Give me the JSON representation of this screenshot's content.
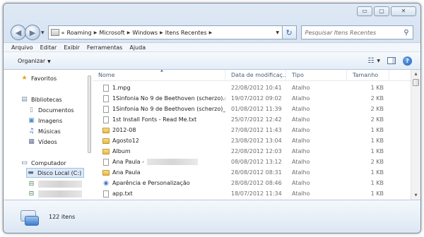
{
  "window": {
    "caption": {
      "minimize": "▭",
      "maximize": "▢",
      "close": "✕"
    }
  },
  "nav": {
    "back_icon": "back-arrow-icon",
    "forward_icon": "forward-arrow-icon",
    "address": {
      "overflow": "«",
      "crumbs": [
        "Roaming",
        "Microsoft",
        "Windows",
        "Itens Recentes"
      ]
    },
    "search_placeholder": "Pesquisar Itens Recentes"
  },
  "menubar": [
    "Arquivo",
    "Editar",
    "Exibir",
    "Ferramentas",
    "Ajuda"
  ],
  "toolbar": {
    "organize_label": "Organizar"
  },
  "navpane": {
    "items": [
      {
        "label": "Favoritos",
        "icon": "star-icon",
        "glyph": "★",
        "color": "#e7a11b"
      },
      {
        "label": "Bibliotecas",
        "icon": "libraries-icon",
        "glyph": "▤",
        "color": "#7a8ca6"
      },
      {
        "label": "Documentos",
        "icon": "documents-icon",
        "glyph": "▯",
        "color": "#8a8a8a"
      },
      {
        "label": "Imagens",
        "icon": "pictures-icon",
        "glyph": "▣",
        "color": "#4f8bc9"
      },
      {
        "label": "Músicas",
        "icon": "music-icon",
        "glyph": "♫",
        "color": "#3d6db5"
      },
      {
        "label": "Vídeos",
        "icon": "videos-icon",
        "glyph": "▦",
        "color": "#5a6f8f"
      },
      {
        "label": "Computador",
        "icon": "computer-icon",
        "glyph": "▭",
        "color": "#3a5a8a"
      },
      {
        "label": "Disco Local (C:)",
        "icon": "drive-icon",
        "glyph": "▬",
        "color": "#5c6f87"
      },
      {
        "label": "",
        "icon": "network-drive-icon",
        "glyph": "⊟",
        "color": "#3e7c3e"
      },
      {
        "label": "",
        "icon": "network-drive-icon",
        "glyph": "⊟",
        "color": "#3e7c3e"
      }
    ]
  },
  "files": {
    "columns": [
      "Nome",
      "Data de modificaç...",
      "Tipo",
      "Tamanho"
    ],
    "rows": [
      {
        "name": "1.mpg",
        "date": "22/08/2012 10:41",
        "type": "Atalho",
        "size": "1 KB",
        "icon": "doc"
      },
      {
        "name": "1Sinfonia No 9 de Beethoven (scherzo).m...",
        "date": "19/07/2012 09:02",
        "type": "Atalho",
        "size": "2 KB",
        "icon": "doc"
      },
      {
        "name": "1Sinfonia No 9 de Beethoven (scherzo)_tr...",
        "date": "01/08/2012 11:39",
        "type": "Atalho",
        "size": "2 KB",
        "icon": "doc"
      },
      {
        "name": "1st Install Fonts - Read Me.txt",
        "date": "25/07/2012 12:42",
        "type": "Atalho",
        "size": "2 KB",
        "icon": "doc"
      },
      {
        "name": "2012-08",
        "date": "27/08/2012 11:43",
        "type": "Atalho",
        "size": "1 KB",
        "icon": "folder"
      },
      {
        "name": "Agosto12",
        "date": "23/08/2012 13:04",
        "type": "Atalho",
        "size": "1 KB",
        "icon": "folder"
      },
      {
        "name": "Album",
        "date": "22/08/2012 12:03",
        "type": "Atalho",
        "size": "1 KB",
        "icon": "folder"
      },
      {
        "name": "Ana Paula -",
        "date": "08/08/2012 13:12",
        "type": "Atalho",
        "size": "2 KB",
        "icon": "doc",
        "redacted": true
      },
      {
        "name": "Ana Paula",
        "date": "28/08/2012 08:31",
        "type": "Atalho",
        "size": "1 KB",
        "icon": "folder"
      },
      {
        "name": "Aparência e Personalização",
        "date": "28/08/2012 08:46",
        "type": "Atalho",
        "size": "1 KB",
        "icon": "theme"
      },
      {
        "name": "app.txt",
        "date": "18/07/2012 11:34",
        "type": "Atalho",
        "size": "1 KB",
        "icon": "doc"
      }
    ]
  },
  "details": {
    "count_text": "122 itens"
  }
}
